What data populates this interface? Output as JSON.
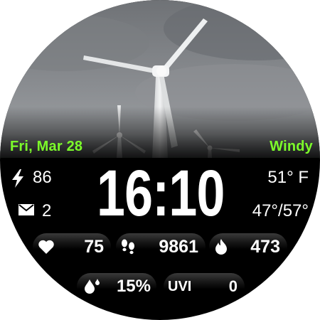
{
  "date": "Fri, Mar 28",
  "weather_condition": "Windy",
  "time": "16:10",
  "battery": {
    "icon": "bolt-icon",
    "value": "86"
  },
  "messages": {
    "icon": "mail-icon",
    "value": "2"
  },
  "temperature": {
    "current": "51° F",
    "range": "47°/57°"
  },
  "metrics": {
    "heart_rate": {
      "icon": "heart-icon",
      "value": "75"
    },
    "steps": {
      "icon": "footsteps-icon",
      "value": "9861"
    },
    "calories": {
      "icon": "flame-icon",
      "value": "473"
    },
    "humidity": {
      "icon": "water-drop-icon",
      "value": "15%"
    },
    "uv_index": {
      "label": "UVI",
      "value": "0"
    }
  },
  "colors": {
    "accent_green": "#7CFC2A",
    "background": "#000000",
    "text": "#FFFFFF"
  }
}
